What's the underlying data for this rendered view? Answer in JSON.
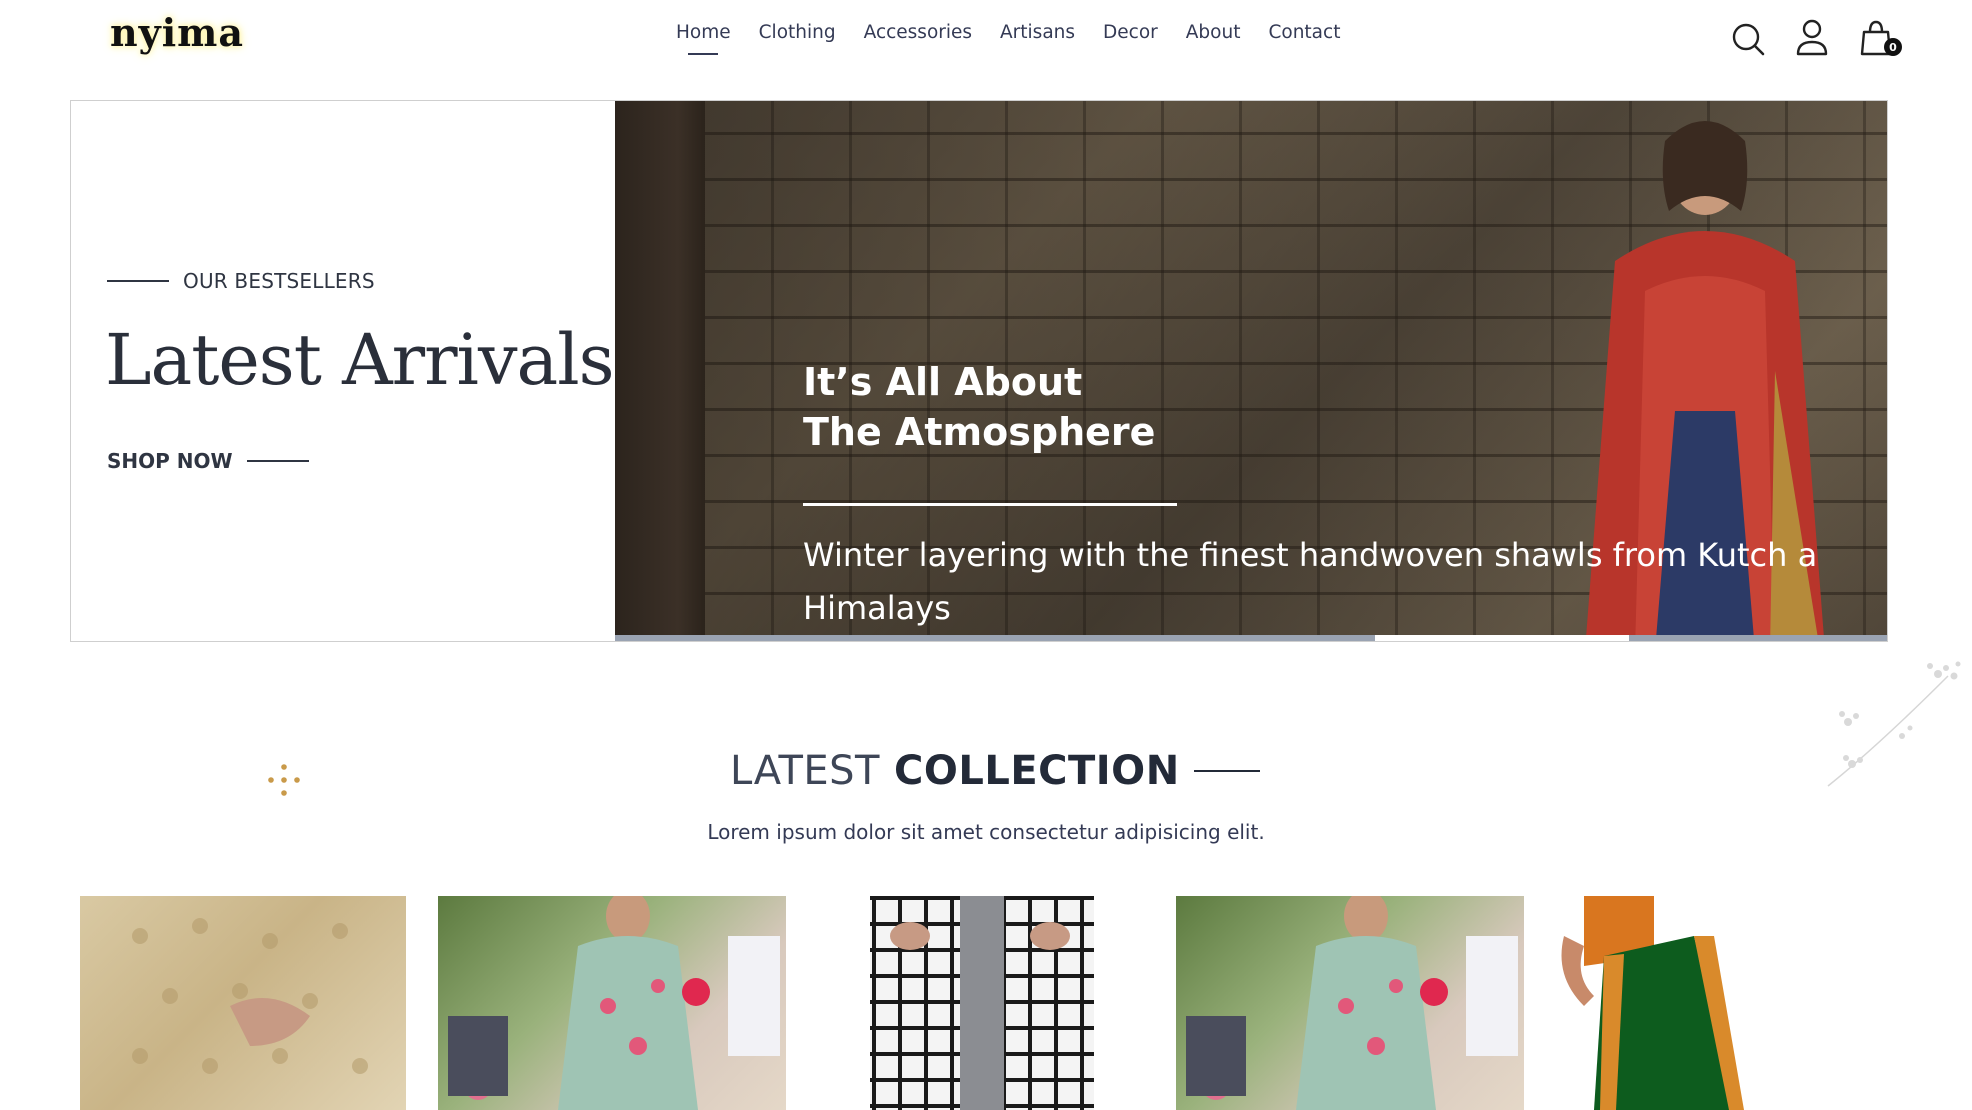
{
  "brand": {
    "logo_text": "nyima"
  },
  "nav": {
    "items": [
      {
        "label": "Home",
        "active": true
      },
      {
        "label": "Clothing"
      },
      {
        "label": "Accessories"
      },
      {
        "label": "Artisans"
      },
      {
        "label": "Decor"
      },
      {
        "label": "About"
      },
      {
        "label": "Contact"
      }
    ]
  },
  "header_icons": {
    "search": "search-icon",
    "account": "user-icon",
    "cart": "shopping-bag-icon",
    "cart_count": "0"
  },
  "hero": {
    "eyebrow": "OUR BESTSELLERS",
    "title": "Latest Arrivals",
    "cta": "SHOP NOW",
    "slide_heading_line1": "It’s All About",
    "slide_heading_line2": "The Atmosphere",
    "slide_subtext": "Winter layering with the finest handwoven shawls from Kutch a Himalays"
  },
  "collection": {
    "title_light": "LATEST",
    "title_bold": "COLLECTION",
    "subtitle": "Lorem ipsum dolor sit amet consectetur adipisicing elit."
  },
  "colors": {
    "text_dark": "#2a2f3a",
    "nav_text": "#343a55",
    "accent_gold": "#c99a4a",
    "slider_track": "#9aa3b2"
  }
}
